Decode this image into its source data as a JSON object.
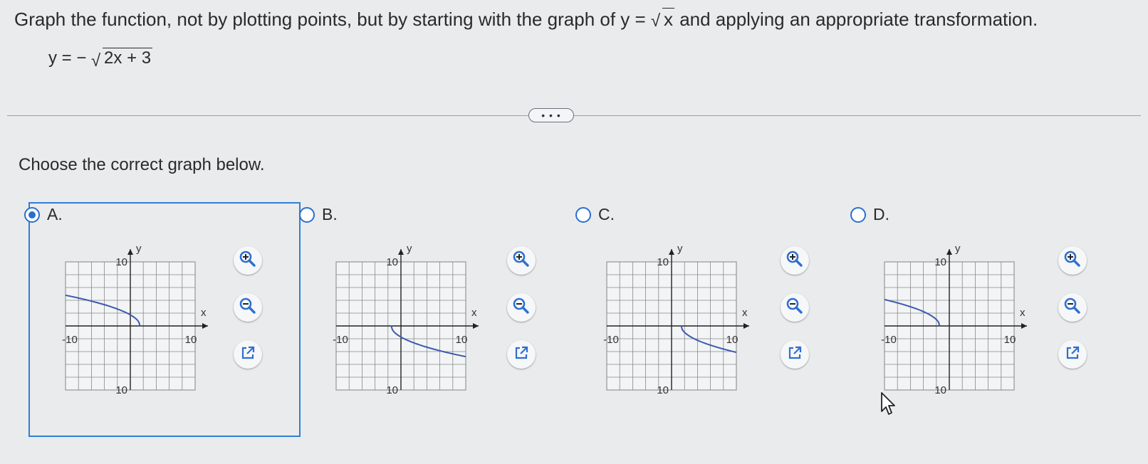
{
  "question": {
    "text_before": "Graph the function, not by plotting points, but by starting with the graph of y =",
    "radicand": "x",
    "text_after": "and applying an appropriate transformation."
  },
  "equation": {
    "lhs": "y = −",
    "radicand": "2x + 3"
  },
  "more_button": "• • •",
  "prompt": "Choose the correct graph below.",
  "options": [
    {
      "letter": "A.",
      "selected": true
    },
    {
      "letter": "B.",
      "selected": false
    },
    {
      "letter": "C.",
      "selected": false
    },
    {
      "letter": "D.",
      "selected": false
    }
  ],
  "graph_labels": {
    "y_axis": "y",
    "x_axis": "x",
    "y_max": "10",
    "y_min": "-10",
    "x_min": "-10",
    "x_max": "10"
  },
  "colors": {
    "accent": "#2f7fd8",
    "curve": "#3b5bb0"
  },
  "icons": [
    "zoom-in-icon",
    "zoom-out-icon",
    "open-external-icon"
  ]
}
